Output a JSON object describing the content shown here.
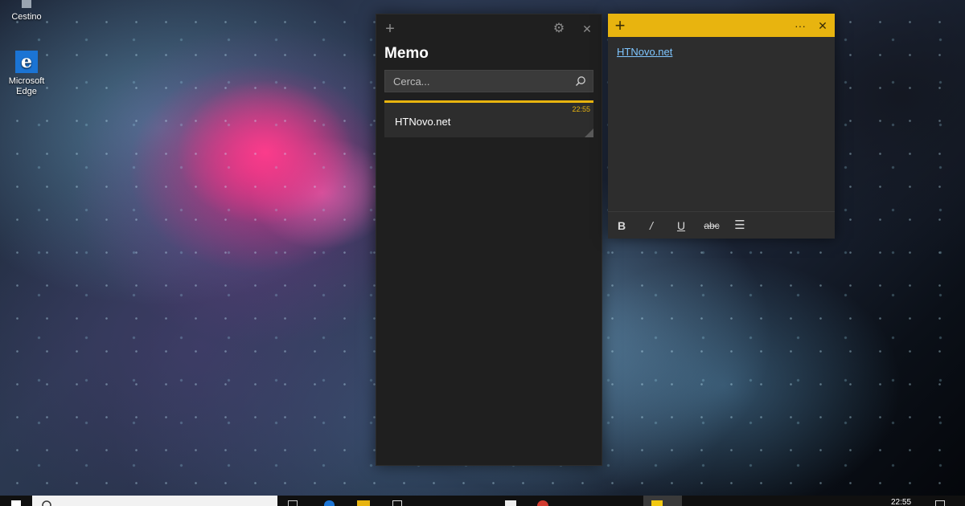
{
  "desktop": {
    "icons": [
      {
        "label": "Cestino",
        "icon": "recycle-bin-icon"
      },
      {
        "label": "Microsoft Edge",
        "icon": "edge-icon",
        "glyph": "e"
      }
    ]
  },
  "list_window": {
    "title": "Memo",
    "add_glyph": "+",
    "settings_glyph": "⚙",
    "close_glyph": "✕",
    "search": {
      "placeholder": "Cerca...",
      "value": ""
    },
    "notes": [
      {
        "time": "22:55",
        "text": "HTNovo.net",
        "accent": "#e8b40f"
      }
    ]
  },
  "note_window": {
    "accent": "#e8b40f",
    "add_glyph": "+",
    "menu_glyph": "···",
    "close_glyph": "✕",
    "content_link": "HTNovo.net",
    "format": {
      "bold": "B",
      "italic": "/",
      "underline": "U",
      "strikethrough": "abc",
      "list": "☰"
    }
  },
  "taskbar": {
    "clock_time": "22:55"
  }
}
